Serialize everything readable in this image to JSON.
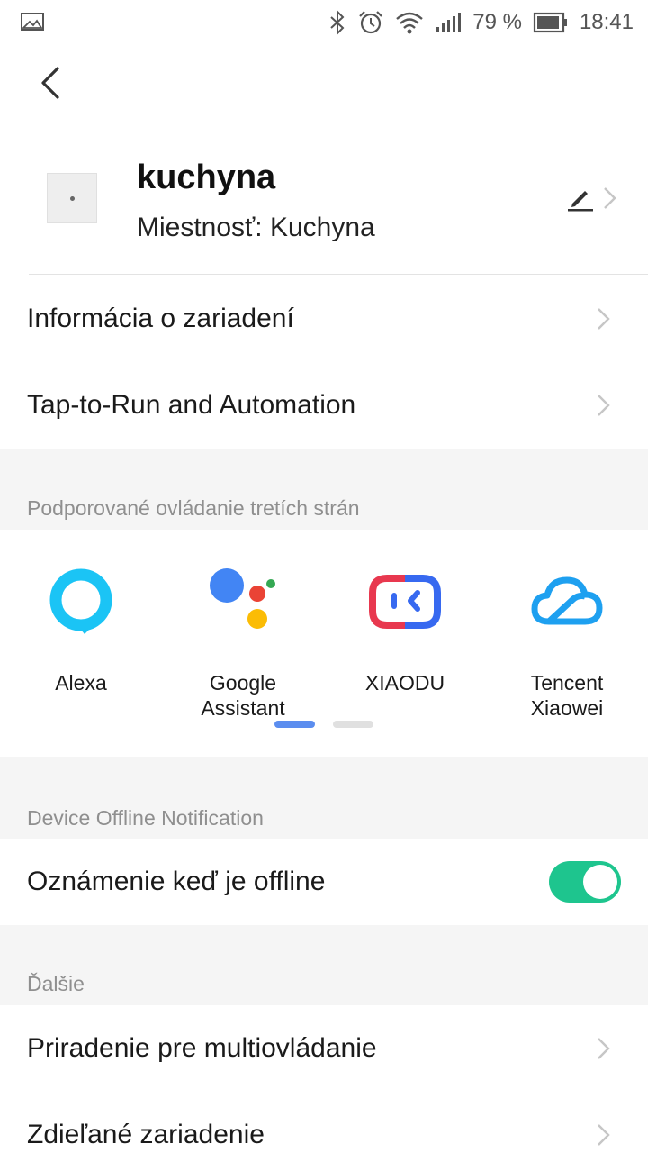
{
  "status_bar": {
    "battery_percent": "79 %",
    "time": "18:41"
  },
  "device": {
    "name": "kuchyna",
    "room": "Miestnosť: Kuchyna"
  },
  "menu": {
    "device_info": "Informácia o zariadení",
    "tap_to_run": "Tap-to-Run and Automation"
  },
  "third_party": {
    "section_title": "Podporované ovládanie tretích strán",
    "items": [
      {
        "label": "Alexa",
        "icon": "alexa-icon"
      },
      {
        "label": "Google\nAssistant",
        "icon": "google-assistant-icon"
      },
      {
        "label": "XIAODU",
        "icon": "xiaodu-icon"
      },
      {
        "label": "Tencent\nXiaowei",
        "icon": "tencent-xiaowei-icon"
      }
    ],
    "pages": 2,
    "active_page": 1
  },
  "offline": {
    "section_title": "Device Offline Notification",
    "label": "Oznámenie keď je offline",
    "enabled": true
  },
  "more": {
    "section_title": "Ďalšie",
    "multi_control": "Priradenie pre multiovládanie",
    "shared_device": "Zdieľané zariadenie"
  },
  "colors": {
    "toggle_on": "#1ec58e",
    "pager_active": "#5b8def",
    "pager_inactive": "#e0e0e0",
    "alexa": "#1bc4f5",
    "xiaodu_blue": "#3769f0",
    "xiaodu_red": "#e8384f",
    "tencent": "#1ea0f0"
  }
}
